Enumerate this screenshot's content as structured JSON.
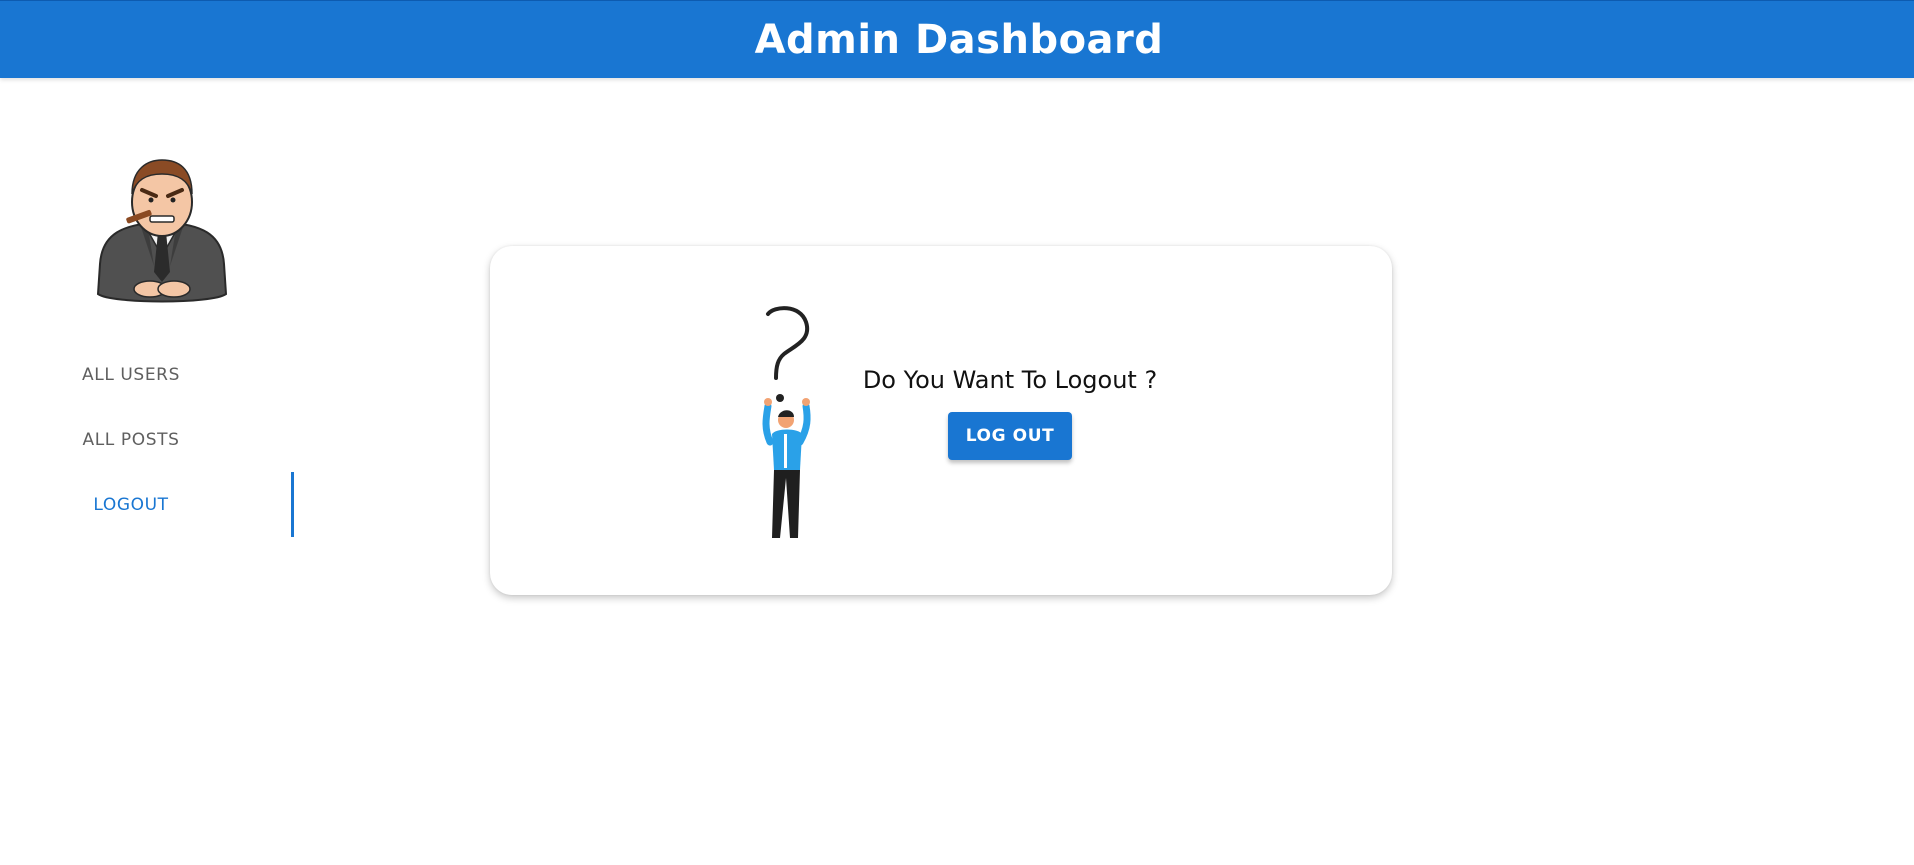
{
  "header": {
    "title": "Admin Dashboard",
    "background_color": "#1976d2"
  },
  "sidebar": {
    "avatar": "businessman-avatar-icon",
    "tabs": [
      {
        "label": "ALL USERS",
        "active": false
      },
      {
        "label": "ALL POSTS",
        "active": false
      },
      {
        "label": "LOGOUT",
        "active": true
      }
    ],
    "active_color": "#1976d2"
  },
  "card": {
    "illustration": "question-mark-person-illustration",
    "question": "Do You Want To Logout ?",
    "button_label": "LOG OUT"
  }
}
